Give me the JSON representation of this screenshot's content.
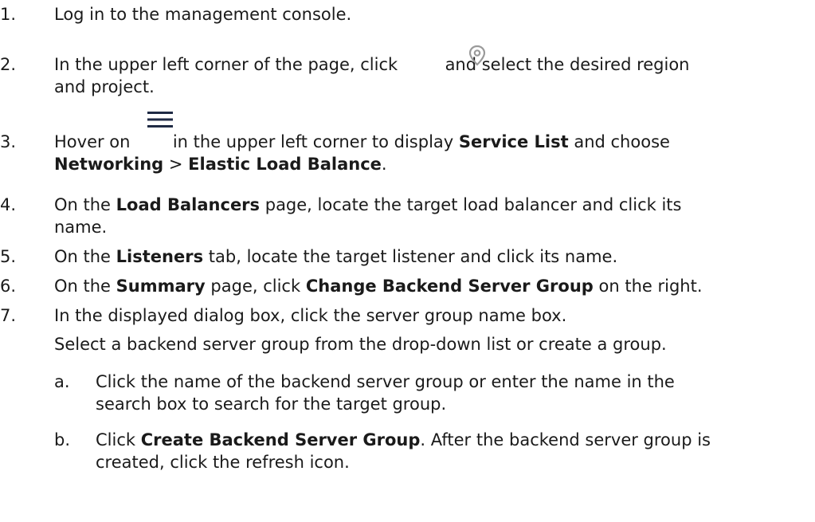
{
  "steps": [
    {
      "num": "1.",
      "text": "Log in to the management console."
    },
    {
      "num": "2.",
      "a": "In the upper left corner of the page, click",
      "b": "and select the desired region",
      "c": "and project.",
      "icon": "location-pin-icon"
    },
    {
      "num": "3.",
      "a": "Hover on",
      "b": "in the upper left corner to display",
      "b_bold": "Service List",
      "c": "and choose",
      "d_bold1": "Networking",
      "d_sep": ">",
      "d_bold2": "Elastic Load Balance",
      "d_end": ".",
      "icon": "hamburger-menu-icon"
    },
    {
      "num": "4.",
      "a": "On the",
      "a_bold": "Load Balancers",
      "b": "page, locate the target load balancer and click its",
      "c": "name."
    },
    {
      "num": "5.",
      "a": "On the",
      "a_bold": "Listeners",
      "b": "tab, locate the target listener and click its name."
    },
    {
      "num": "6.",
      "a": "On the",
      "a_bold": "Summary",
      "b": "page, click",
      "b_bold": "Change Backend Server Group",
      "c": "on the right."
    },
    {
      "num": "7.",
      "a": "In the displayed dialog box, click the server group name box.",
      "b": "Select a backend server group from the drop-down list or create a group."
    }
  ],
  "substeps": [
    {
      "letter": "a.",
      "l1": "Click the name of the backend server group or enter the name in the",
      "l2": "search box to search for the target group."
    },
    {
      "letter": "b.",
      "l1a": "Click",
      "l1_bold": "Create Backend Server Group",
      "l1b": ". After the backend server group is",
      "l2": "created, click the refresh icon."
    }
  ],
  "colors": {
    "text": "#1a1a1a",
    "icon_gray": "#9a9a9a",
    "icon_navy": "#1f2a44"
  }
}
